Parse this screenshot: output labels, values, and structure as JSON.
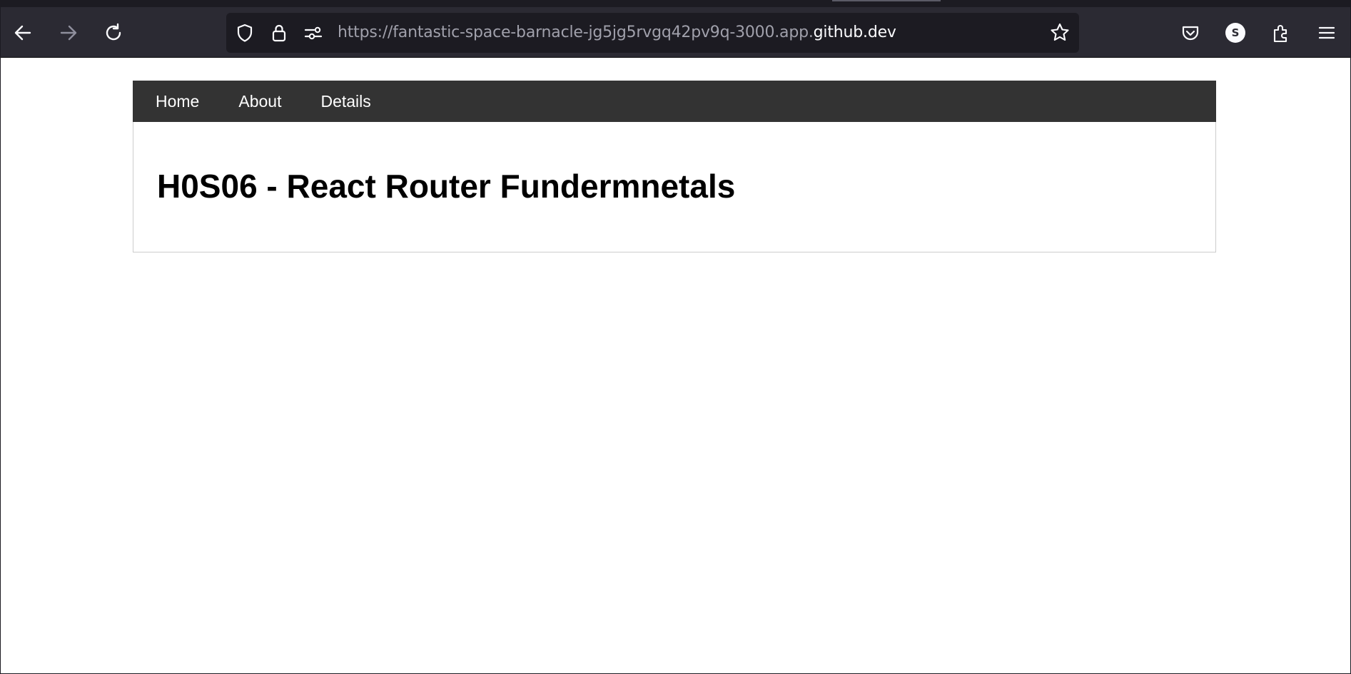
{
  "browser": {
    "url_prefix": "https://fantastic-space-barnacle-jg5jg5rvgq42pv9q-3000.app.",
    "url_domain": "github.dev",
    "profile_initial": "S",
    "toolbar_icons": [
      "back-icon",
      "forward-icon",
      "reload-icon",
      "shield-icon",
      "lock-icon",
      "permissions-icon",
      "bookmark-star-icon",
      "pocket-icon",
      "extensions-icon",
      "menu-icon"
    ],
    "colors": {
      "chrome": "#2b2a33",
      "urlbar": "#1c1b22"
    }
  },
  "page": {
    "nav": {
      "items": [
        {
          "label": "Home"
        },
        {
          "label": "About"
        },
        {
          "label": "Details"
        }
      ]
    },
    "title": "H0S06 - React Router Fundermnetals",
    "colors": {
      "navbar": "#333333",
      "nav_text": "#ffffff"
    }
  }
}
